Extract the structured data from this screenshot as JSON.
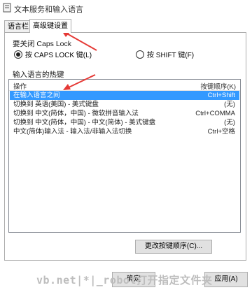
{
  "window": {
    "title": "文本服务和输入语言"
  },
  "tabs": [
    {
      "label": "语言栏"
    },
    {
      "label": "高级键设置"
    }
  ],
  "caps_section": {
    "label": "要关闭 Caps Lock",
    "option_capslock": "按 CAPS LOCK 键(L)",
    "option_shift": "按 SHIFT 键(F)"
  },
  "hotkey_section": {
    "label": "输入语言的热键",
    "col_action": "操作",
    "col_key": "按键顺序(K)",
    "rows": [
      {
        "action": "在输入语言之间",
        "key": "Ctrl+Shift"
      },
      {
        "action": "切换到 英语(美国) - 美式键盘",
        "key": "(无)"
      },
      {
        "action": "切换到 中文(简体，中国) - 微软拼音输入法",
        "key": "Ctrl+COMMA"
      },
      {
        "action": "切换到 中文(简体，中国) - 中文(简体) - 美式键盘",
        "key": "(无)"
      },
      {
        "action": "中文(简体)输入法 - 输入法/非输入法切换",
        "key": "Ctrl+空格"
      }
    ]
  },
  "change_button": "更改按键顺序(C)...",
  "bottom": {
    "ok": "确定",
    "apply": "应用(A)"
  },
  "watermark": "vb.net|*|_robot打开指定文件夹",
  "colors": {
    "selection": "#3399ff",
    "annotation_arrow": "#e53935"
  }
}
